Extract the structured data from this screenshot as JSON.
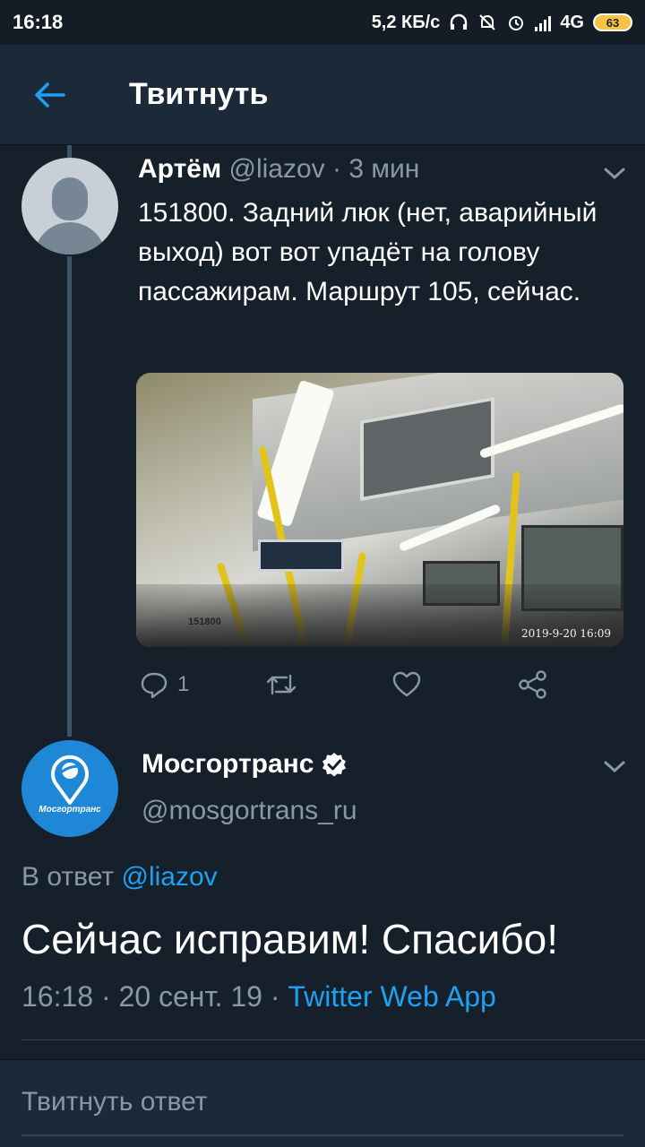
{
  "status_bar": {
    "time": "16:18",
    "speed": "5,2 КБ/с",
    "network": "4G",
    "battery": "63"
  },
  "header": {
    "title": "Твитнуть"
  },
  "tweet1": {
    "name": "Артём",
    "handle": "@liazov",
    "separator": "·",
    "time": "3 мин",
    "text": "151800. Задний люк (нет, аварийный выход) вот вот упадёт на голову пассажирам. Маршрут 105, сейчас.",
    "media": {
      "timestamp": "2019-9-20 16:09",
      "bus_number": "151800"
    },
    "actions": {
      "reply_count": "1"
    }
  },
  "tweet2": {
    "name": "Мосгортранс",
    "handle": "@mosgortrans_ru",
    "avatar_label": "Мосгортранс",
    "reply_prefix": "В ответ",
    "reply_mention": "@liazov",
    "text": "Сейчас исправим! Спасибо!",
    "time": "16:18",
    "separator": "·",
    "date": "20 сент. 19",
    "source": "Twitter Web App"
  },
  "composer": {
    "placeholder": "Твитнуть ответ"
  },
  "colors": {
    "background": "#15202b",
    "header": "#1c2938",
    "accent": "#1da1f2",
    "muted": "#8899a6",
    "verified": "#ffffff"
  }
}
